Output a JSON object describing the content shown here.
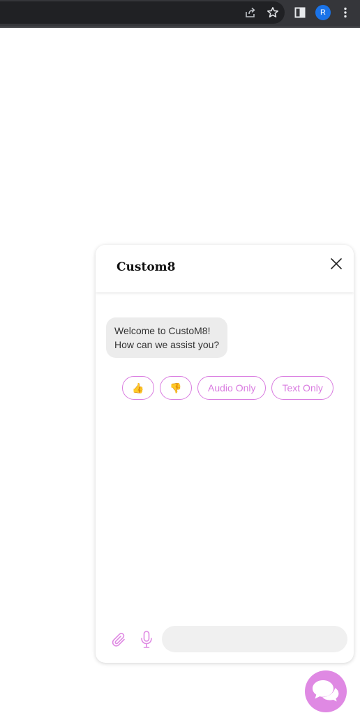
{
  "browser": {
    "profile_initial": "R",
    "icons": [
      "share-icon",
      "bookmark-star-icon",
      "side-panel-icon",
      "more-vert-icon"
    ]
  },
  "chat": {
    "title": "Custom8",
    "close_icon": "close-icon",
    "messages": [
      {
        "line1": "Welcome to CustoM8!",
        "line2": "How can we assist you?"
      }
    ],
    "quick_replies": {
      "thumbs_up": "👍",
      "thumbs_down": "👎",
      "audio_only": "Audio Only",
      "text_only": "Text Only"
    },
    "composer": {
      "input_value": "",
      "input_placeholder": "",
      "attach_icon": "paperclip-icon",
      "mic_icon": "microphone-icon"
    }
  },
  "launcher": {
    "icon": "chat-bubbles-icon"
  },
  "colors": {
    "accent": "#df89e3",
    "accent_border": "#d97be0",
    "bubble_bg": "#ececec",
    "toolbar_bg": "#35363a",
    "avatar_bg": "#1a73e8"
  }
}
